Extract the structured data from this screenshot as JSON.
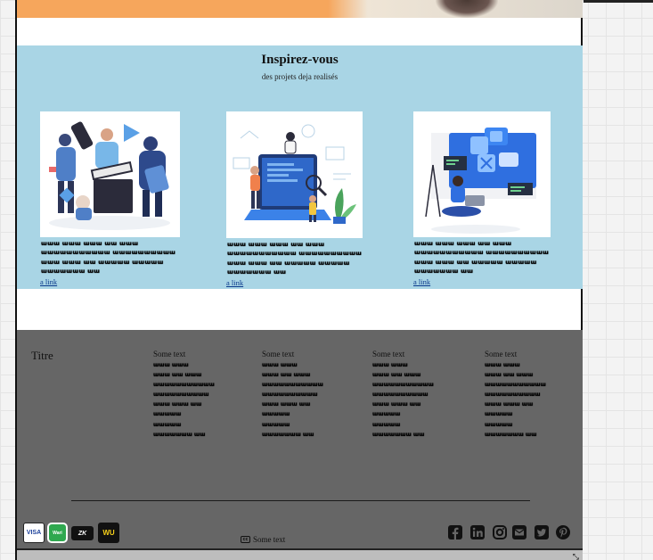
{
  "inspire": {
    "title": "Inspirez-vous",
    "subtitle": "des projets deja realisés",
    "cards": [
      {
        "description": "ɯɯɯ ɯɯɯ ɯɯɯ ɯɯ ɯɯɯ ɯɯɯɯɯɯɯɯɯɯɯ ɯɯɯɯɯɯɯɯɯɯ ɯɯɯ ɯɯɯ ɯɯ ɯɯɯɯɯ ɯɯɯɯɯ ɯɯɯɯɯɯɯ ɯɯ",
        "link": "a link"
      },
      {
        "description": "ɯɯɯ ɯɯɯ ɯɯɯ ɯɯ ɯɯɯ ɯɯɯɯɯɯɯɯɯɯɯ ɯɯɯɯɯɯɯɯɯɯ ɯɯɯ ɯɯɯ ɯɯ ɯɯɯɯɯ ɯɯɯɯɯ ɯɯɯɯɯɯɯ ɯɯ",
        "link": "a link"
      },
      {
        "description": "ɯɯɯ ɯɯɯ ɯɯɯ ɯɯ ɯɯɯ ɯɯɯɯɯɯɯɯɯɯɯ ɯɯɯɯɯɯɯɯɯɯ ɯɯɯ ɯɯɯ ɯɯ ɯɯɯɯɯ ɯɯɯɯɯ ɯɯɯɯɯɯɯ ɯɯ",
        "link": "a link"
      }
    ]
  },
  "footer": {
    "title": "Titre",
    "columns": [
      {
        "heading": "Some text",
        "text": "ɯɯɯ ɯɯɯ ɯɯɯ ɯɯ ɯɯɯ ɯɯɯɯɯɯɯɯɯɯɯ ɯɯɯɯɯɯɯɯɯɯ ɯɯɯ ɯɯɯ ɯɯ ɯɯɯɯɯ ɯɯɯɯɯ ɯɯɯɯɯɯɯ ɯɯ"
      },
      {
        "heading": "Some text",
        "text": "ɯɯɯ ɯɯɯ ɯɯɯ ɯɯ ɯɯɯ ɯɯɯɯɯɯɯɯɯɯɯ ɯɯɯɯɯɯɯɯɯɯ ɯɯɯ ɯɯɯ ɯɯ ɯɯɯɯɯ ɯɯɯɯɯ ɯɯɯɯɯɯɯ ɯɯ"
      },
      {
        "heading": "Some text",
        "text": "ɯɯɯ ɯɯɯ ɯɯɯ ɯɯ ɯɯɯ ɯɯɯɯɯɯɯɯɯɯɯ ɯɯɯɯɯɯɯɯɯɯ ɯɯɯ ɯɯɯ ɯɯ ɯɯɯɯɯ ɯɯɯɯɯ ɯɯɯɯɯɯɯ ɯɯ"
      },
      {
        "heading": "Some text",
        "text": "ɯɯɯ ɯɯɯ ɯɯɯ ɯɯ ɯɯɯ ɯɯɯɯɯɯɯɯɯɯɯ ɯɯɯɯɯɯɯɯɯɯ ɯɯɯ ɯɯɯ ɯɯ ɯɯɯɯɯ ɯɯɯɯɯ ɯɯɯɯɯɯɯ ɯɯ"
      }
    ],
    "payments": {
      "visa": "VISA",
      "wari": "Wari",
      "moneygram": "ZK",
      "western_union": "WU"
    },
    "copyright_icon": "cc",
    "copyright_text": "Some text",
    "social_icons": [
      "facebook-icon",
      "linkedin-icon",
      "instagram-icon",
      "envelope-icon",
      "twitter-icon",
      "pinterest-icon"
    ]
  },
  "colors": {
    "inspire_bg": "#a9d5e5",
    "footer_bg": "#666666",
    "banner_accent": "#f6a65c",
    "link": "#0b3a8c"
  }
}
